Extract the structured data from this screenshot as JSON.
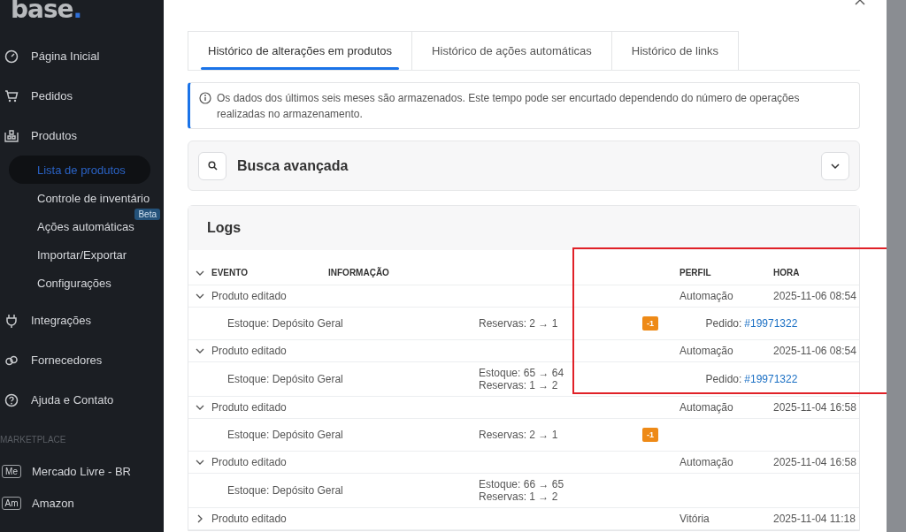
{
  "sidebar": {
    "logo": "base.",
    "items": [
      {
        "label": "Página Inicial"
      },
      {
        "label": "Pedidos"
      },
      {
        "label": "Produtos",
        "children": [
          {
            "label": "Lista de produtos",
            "selected": true
          },
          {
            "label": "Controle de inventário",
            "selected": false
          },
          {
            "label": "Ações automáticas",
            "selected": false,
            "badge": "Beta"
          },
          {
            "label": "Importar/Exportar",
            "selected": false
          },
          {
            "label": "Configurações",
            "selected": false
          }
        ]
      },
      {
        "label": "Integrações"
      },
      {
        "label": "Fornecedores"
      },
      {
        "label": "Ajuda e Contato"
      }
    ],
    "section": "MARKETPLACE",
    "marketplaces": [
      {
        "code": "Me",
        "label": "Mercado Livre - BR"
      },
      {
        "code": "Am",
        "label": "Amazon"
      }
    ]
  },
  "tabs": [
    {
      "label": "Histórico de alterações em produtos",
      "selected": true
    },
    {
      "label": "Histórico de ações automáticas",
      "selected": false
    },
    {
      "label": "Histórico de links",
      "selected": false
    }
  ],
  "notice": "Os dados dos últimos seis meses são armazenados. Este tempo pode ser encurtado dependendo do número de operações realizadas no armazenamento.",
  "search": {
    "label": "Busca avançada",
    "expanded": false
  },
  "logs": {
    "title": "Logs",
    "columns": [
      "EVENTO",
      "INFORMAÇÃO",
      "PERFIL",
      "HORA"
    ],
    "rows": [
      {
        "event": "Produto editado",
        "profile": "Automação",
        "time": "2025-11-06 08:54",
        "expanded": true,
        "detail": {
          "location": "Estoque: Depósito Geral",
          "changes": [
            "Reservas: 2 → 1"
          ],
          "badge": "-1",
          "order_label": "Pedido:",
          "order_link": "#19971322"
        }
      },
      {
        "event": "Produto editado",
        "profile": "Automação",
        "time": "2025-11-06 08:54",
        "expanded": true,
        "detail": {
          "location": "Estoque: Depósito Geral",
          "changes": [
            "Estoque: 65 → 64",
            "Reservas: 1 → 2"
          ],
          "order_label": "Pedido:",
          "order_link": "#19971322"
        }
      },
      {
        "event": "Produto editado",
        "profile": "Automação",
        "time": "2025-11-04 16:58",
        "expanded": true,
        "detail": {
          "location": "Estoque: Depósito Geral",
          "changes": [
            "Reservas: 2 → 1"
          ],
          "badge": "-1"
        }
      },
      {
        "event": "Produto editado",
        "profile": "Automação",
        "time": "2025-11-04 16:58",
        "expanded": true,
        "detail": {
          "location": "Estoque: Depósito Geral",
          "changes": [
            "Estoque: 66 → 65",
            "Reservas: 1 → 2"
          ]
        }
      },
      {
        "event": "Produto editado",
        "profile": "Vitória",
        "time": "2025-11-04 11:18",
        "expanded": false
      }
    ]
  }
}
